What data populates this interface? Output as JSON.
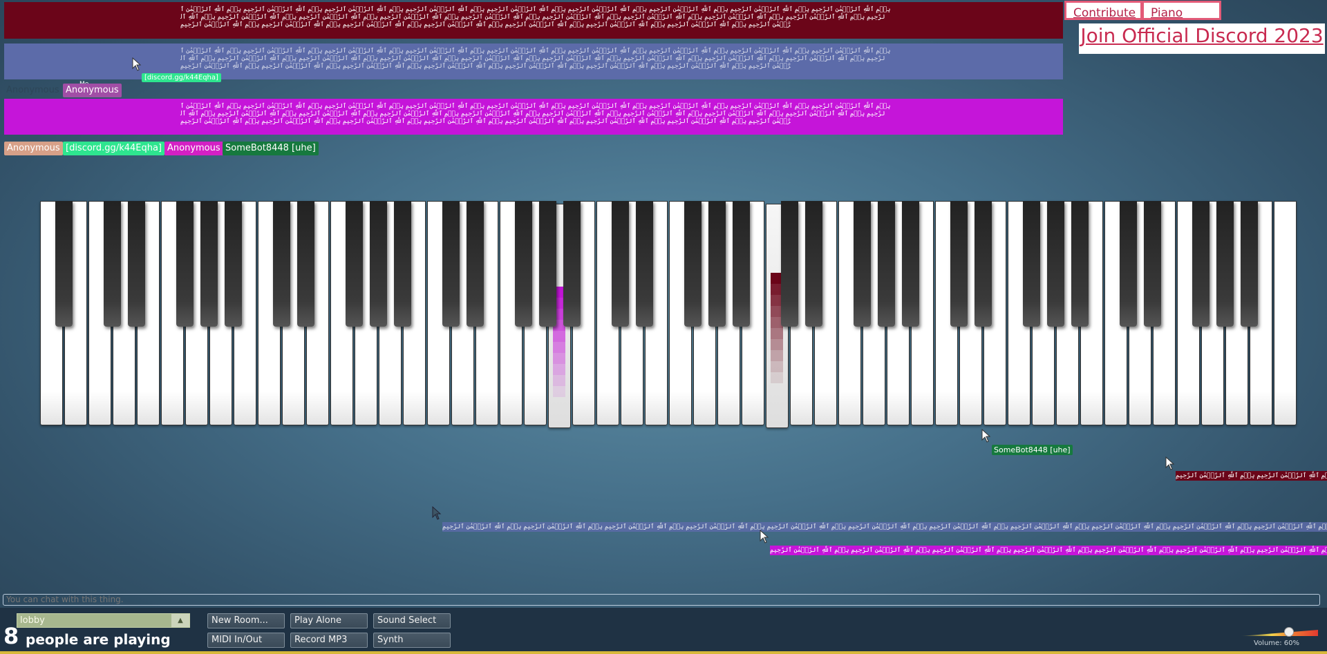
{
  "header": {
    "contribute_label": "Contribute",
    "blog_label": "Piano Blog",
    "discord_label": "Join Official Discord 2023"
  },
  "spam_text": "بِسۡمِ ٱللَّهِ ٱلرَّحۡمَٰنِ ٱلرَّحِيمِ بِسۡمِ ٱللَّهِ ٱلرَّحۡمَٰنِ ٱلرَّحِيمِ بِسۡمِ ٱللَّهِ ٱلرَّحۡمَٰنِ ٱلرَّحِيمِ بِسۡمِ ٱللَّهِ ٱلرَّحۡمَٰنِ ٱلرَّحِيمِ بِسۡمِ ٱللَّهِ ٱلرَّحۡمَٰنِ ٱلرَّحِيمِ بِسۡمِ ٱللَّهِ ٱلرَّحۡمَٰنِ ٱلرَّحِيمِ بِسۡمِ ٱللَّهِ ٱلرَّحۡمَٰنِ ٱلرَّحِيمِ بِسۡمِ ٱللَّهِ ٱلرَّحۡمَٰنِ ٱلرَّحِيمِ بِسۡمِ ٱللَّهِ ٱلرَّحۡمَٰنِ ٱلرَّحِيمِ بِسۡمِ ٱللَّهِ ٱلرَّحۡمَٰنِ ٱلرَّحِيمِ بِسۡمِ ٱللَّهِ ٱلرَّحۡمَٰنِ ٱلرَّحِيمِ بِسۡمِ ٱللَّهِ ٱلرَّحۡمَٰنِ ٱلرَّحِيمِ بِسۡمِ ٱللَّهِ ٱلرَّحۡمَٰنِ ٱلرَّحِيمِ بِسۡمِ ٱللَّهِ ٱلرَّحۡمَٰنِ ٱلرَّحِيمِ بِسۡمِ ٱللَّهِ ٱلرَّحۡمَٰنِ ٱلرَّحِيمِ بِسۡمِ ٱللَّهِ ٱلرَّحۡمَٰنِ ٱلرَّحِيمِ بِسۡمِ ٱللَّهِ ٱلرَّحۡمَٰنِ ٱلرَّحِيمِ بِسۡمِ ٱللَّهِ ٱلرَّحۡمَٰنِ ٱلرَّحِيمِ بِسۡمِ ٱللَّهِ ٱلرَّحۡمَٰنِ ٱلرَّحِيمِ بِسۡمِ ٱللَّهِ ٱلرَّحۡمَٰنِ ٱلرَّحِيمِ بِسۡمِ ٱللَّهِ ٱلرَّحۡمَٰنِ ٱلرَّحِيمِ بِسۡمِ ٱللَّهِ ٱلرَّحۡمَٰنِ ٱلرَّحِيمِ بِسۡمِ ٱللَّهِ ٱلرَّحۡمَٰنِ ٱلرَّحِيمِ بِسۡمِ ٱللَّهِ ٱلرَّحۡمَٰنِ ٱلرَّحِيمِ بِسۡمِ ٱللَّهِ ٱلرَّحۡمَٰنِ ٱلرَّحِيمِ",
  "users": {
    "anonymous_faded": "Anonymous",
    "me_tag": "Me",
    "me_name": "Anonymous",
    "discord_float": "[discord.gg/k44Eqha]",
    "list": [
      "Anonymous",
      "[discord.gg/k44Eqha]",
      "Anonymous",
      "SomeBot8448 [uhe]"
    ]
  },
  "cursor_label": "SomeBot8448 [uhe]",
  "chat": {
    "placeholder": "You can chat with this thing."
  },
  "room": {
    "name": "lobby"
  },
  "player_count": "8",
  "player_count_label": "people are playing",
  "buttons": {
    "new_room": "New Room...",
    "play_alone": "Play Alone",
    "sound_select": "Sound Select",
    "midi": "MIDI In/Out",
    "record": "Record MP3",
    "synth": "Synth"
  },
  "volume": {
    "label": "Volume: 60%",
    "level": 0.6
  },
  "colors": {
    "dark_red": "#6b0519",
    "periwinkle": "#5c6ba9",
    "magenta": "#c515d9",
    "peach": "#d7a088",
    "mint": "#2ee58f",
    "pink": "#d420c4",
    "forest": "#16793e"
  },
  "piano": {
    "white_key_count": 52,
    "pressed_white_keys": [
      21,
      30
    ]
  }
}
